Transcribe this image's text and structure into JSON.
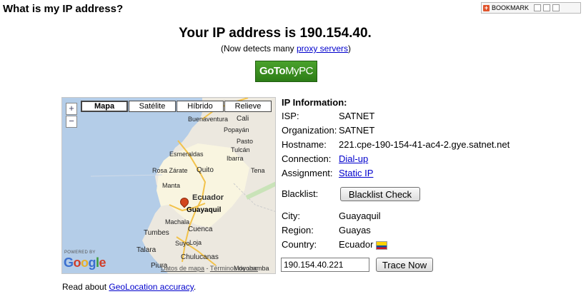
{
  "page": {
    "title": "What is my IP address?",
    "ip_heading": "Your IP address is 190.154.40.",
    "detects_prefix": "(Now detects many ",
    "detects_link": "proxy servers",
    "detects_suffix": ")",
    "read_about_prefix": "Read about ",
    "read_about_link": "GeoLocation accuracy",
    "read_about_suffix": "."
  },
  "bookmark": {
    "label": "BOOKMARK"
  },
  "ad": {
    "label_go": "GoTo",
    "label_my": "MyPC"
  },
  "map": {
    "types": [
      "Mapa",
      "Satélite",
      "Híbrido",
      "Relieve"
    ],
    "active_type": "Mapa",
    "zoom_in": "+",
    "zoom_out": "−",
    "cities": {
      "buenaventura": "Buenaventura",
      "cali": "Cali",
      "popayan": "Popayán",
      "pasto": "Pasto",
      "esmeraldas": "Esmeraldas",
      "tulcan": "Tulcán",
      "ibarra": "Ibarra",
      "rosa_zarate": "Rosa Zárate",
      "quito": "Quito",
      "tena": "Tena",
      "manta": "Manta",
      "guayaquil": "Guayaquil",
      "machala": "Machala",
      "cuenca": "Cuenca",
      "tumbes": "Tumbes",
      "loja": "Loja",
      "talara": "Talara",
      "suyo": "Suyo",
      "chulucanas": "Chulucanas",
      "piura": "Piura",
      "moyobamba": "Moyobamba"
    },
    "country_label": "Ecuador",
    "powered_by": "POWERED BY",
    "google": "Google",
    "footer_data": "Datos de mapa",
    "footer_terms": "Términos de uso",
    "colors": {
      "water": "#b4cde8",
      "land": "#ece8df",
      "highlight": "#f9f5e0",
      "road": "#f2c24a"
    }
  },
  "info": {
    "title": "IP Information:",
    "isp_label": "ISP:",
    "isp_value": "SATNET",
    "org_label": "Organization:",
    "org_value": "SATNET",
    "hostname_label": "Hostname:",
    "hostname_value": "221.cpe-190-154-41-ac4-2.gye.satnet.net",
    "connection_label": "Connection:",
    "connection_value": "Dial-up",
    "assignment_label": "Assignment:",
    "assignment_value": "Static IP",
    "blacklist_label": "Blacklist:",
    "blacklist_button": "Blacklist Check",
    "city_label": "City:",
    "city_value": "Guayaquil",
    "region_label": "Region:",
    "region_value": "Guayas",
    "country_label": "Country:",
    "country_value": "Ecuador",
    "trace_input": "190.154.40.221",
    "trace_button": "Trace Now"
  }
}
